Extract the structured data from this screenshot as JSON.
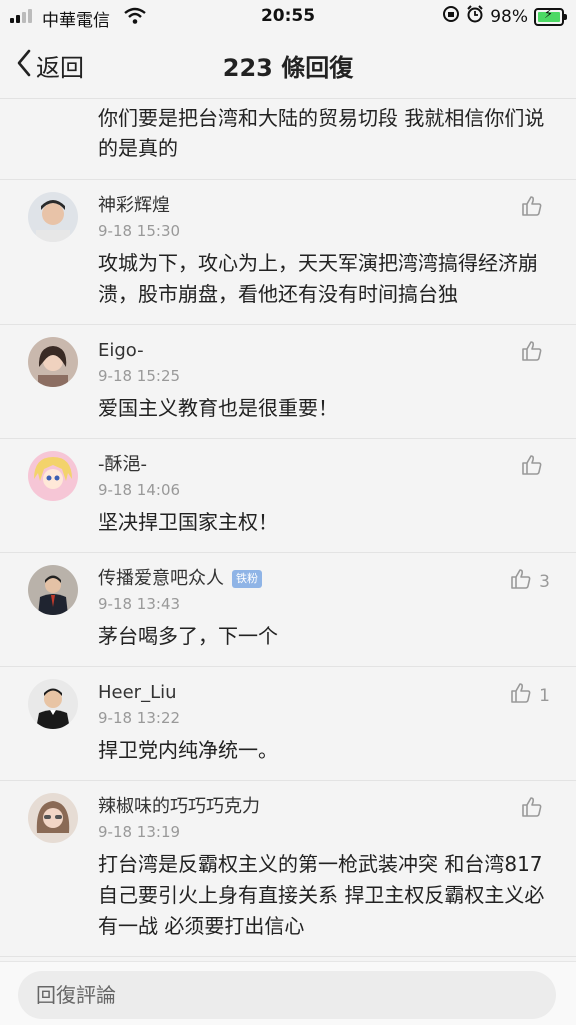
{
  "status_bar": {
    "carrier": "中華電信",
    "time": "20:55",
    "battery": "98%",
    "battery_level": 0.98
  },
  "nav": {
    "back_label": "返回",
    "title": "223 條回復"
  },
  "top_continuation": "你们要是把台湾和大陆的贸易切段 我就相信你们说的是真的",
  "comments": [
    {
      "user": "神彩辉煌",
      "time": "9-18 15:30",
      "text": "攻城为下，攻心为上，天天军演把湾湾搞得经济崩溃，股市崩盘，看他还有没有时间搞台独",
      "likes": ""
    },
    {
      "user": "Eigo-",
      "time": "9-18 15:25",
      "text": "爱国主义教育也是很重要！",
      "likes": ""
    },
    {
      "user": "-酥浥-",
      "time": "9-18 14:06",
      "text": "坚决捍卫国家主权！",
      "likes": ""
    },
    {
      "user": "传播爱意吧众人",
      "badge": "铁粉",
      "time": "9-18 13:43",
      "text": "茅台喝多了，下一个",
      "likes": "3"
    },
    {
      "user": "Heer_Liu",
      "time": "9-18 13:22",
      "text": "捍卫党内纯净统一。",
      "likes": "1"
    },
    {
      "user": "辣椒味的巧巧巧克力",
      "time": "9-18 13:19",
      "text": "打台湾是反霸权主义的第一枪武装冲突 和台湾817 自己要引火上身有直接关系 捍卫主权反霸权主义必有一战 必须要打出信心",
      "likes": ""
    }
  ],
  "reply_placeholder": "回復評論",
  "icons": {
    "back": "chevron-left-icon",
    "like": "thumbs-up-icon",
    "wifi": "wifi-icon",
    "alarm": "alarm-icon",
    "lock": "rotation-lock-icon"
  },
  "colors": {
    "accent_green": "#4cd964",
    "badge_blue": "#8fb4e6"
  }
}
